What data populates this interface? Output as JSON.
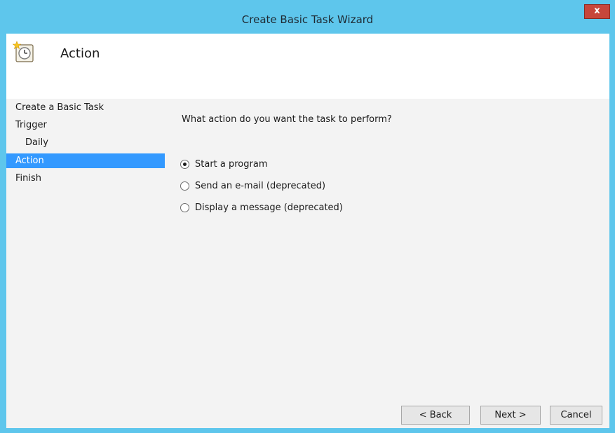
{
  "window": {
    "title": "Create Basic Task Wizard",
    "close_label": "x"
  },
  "header": {
    "title": "Action",
    "icon": "task-scheduler-clock-icon"
  },
  "nav": {
    "items": [
      {
        "label": "Create a Basic Task"
      },
      {
        "label": "Trigger"
      },
      {
        "label": "Daily"
      },
      {
        "label": "Action",
        "active": true
      },
      {
        "label": "Finish"
      }
    ]
  },
  "main": {
    "question": "What action do you want the task to perform?",
    "options": [
      {
        "label": "Start a program",
        "selected": true
      },
      {
        "label": "Send an e-mail (deprecated)",
        "selected": false
      },
      {
        "label": "Display a message (deprecated)",
        "selected": false
      }
    ]
  },
  "buttons": {
    "back": "< Back",
    "next": "Next >",
    "cancel": "Cancel"
  },
  "colors": {
    "titlebar": "#5ec6ec",
    "selection": "#3399ff",
    "close": "#c7463b"
  }
}
